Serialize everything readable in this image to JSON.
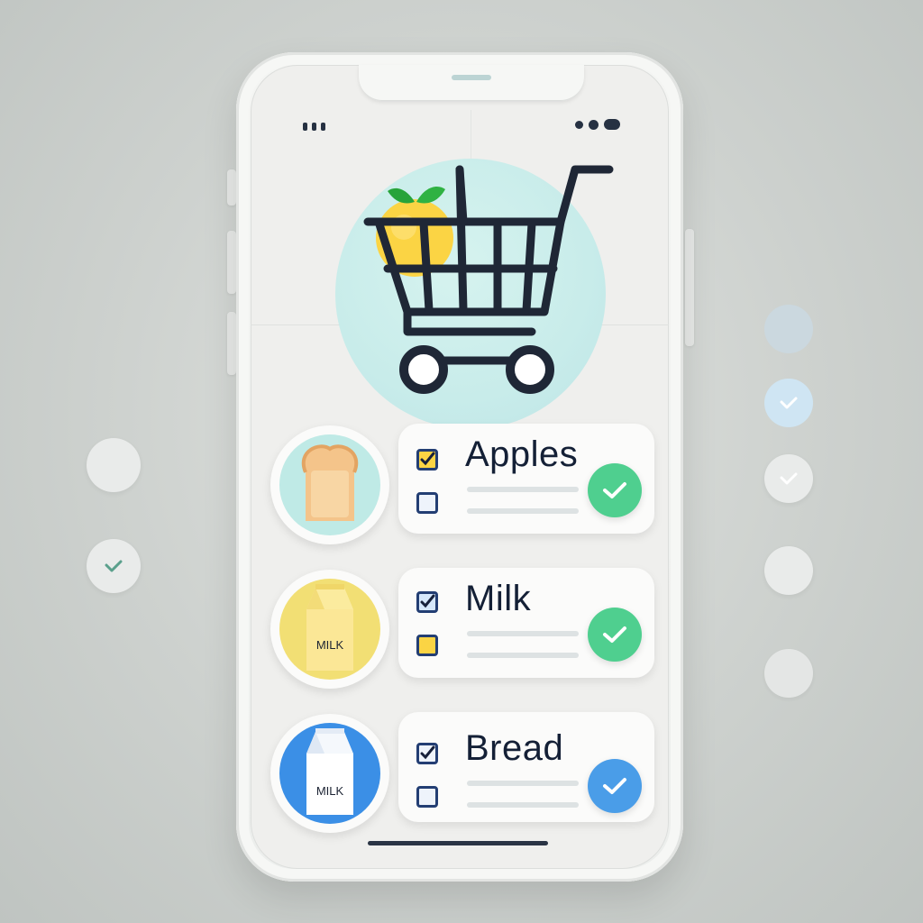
{
  "colors": {
    "accent_teal": "#c8ecea",
    "check_green": "#4fcf8f",
    "check_blue": "#4a9de8",
    "text_dark": "#142036",
    "checkbox_border": "#233e73"
  },
  "header": {
    "hero_icon": "shopping-cart-icon"
  },
  "items": [
    {
      "label": "Apples",
      "icon": "bread-icon",
      "checked": true,
      "done_icon": "check-icon"
    },
    {
      "label": "Milk",
      "icon": "milk-carton-icon",
      "icon_text": "MILK",
      "checked": true,
      "done_icon": "check-icon"
    },
    {
      "label": "Bread",
      "icon": "milk-carton-icon",
      "icon_text": "MILK",
      "checked": true,
      "done_icon": "check-icon"
    }
  ]
}
